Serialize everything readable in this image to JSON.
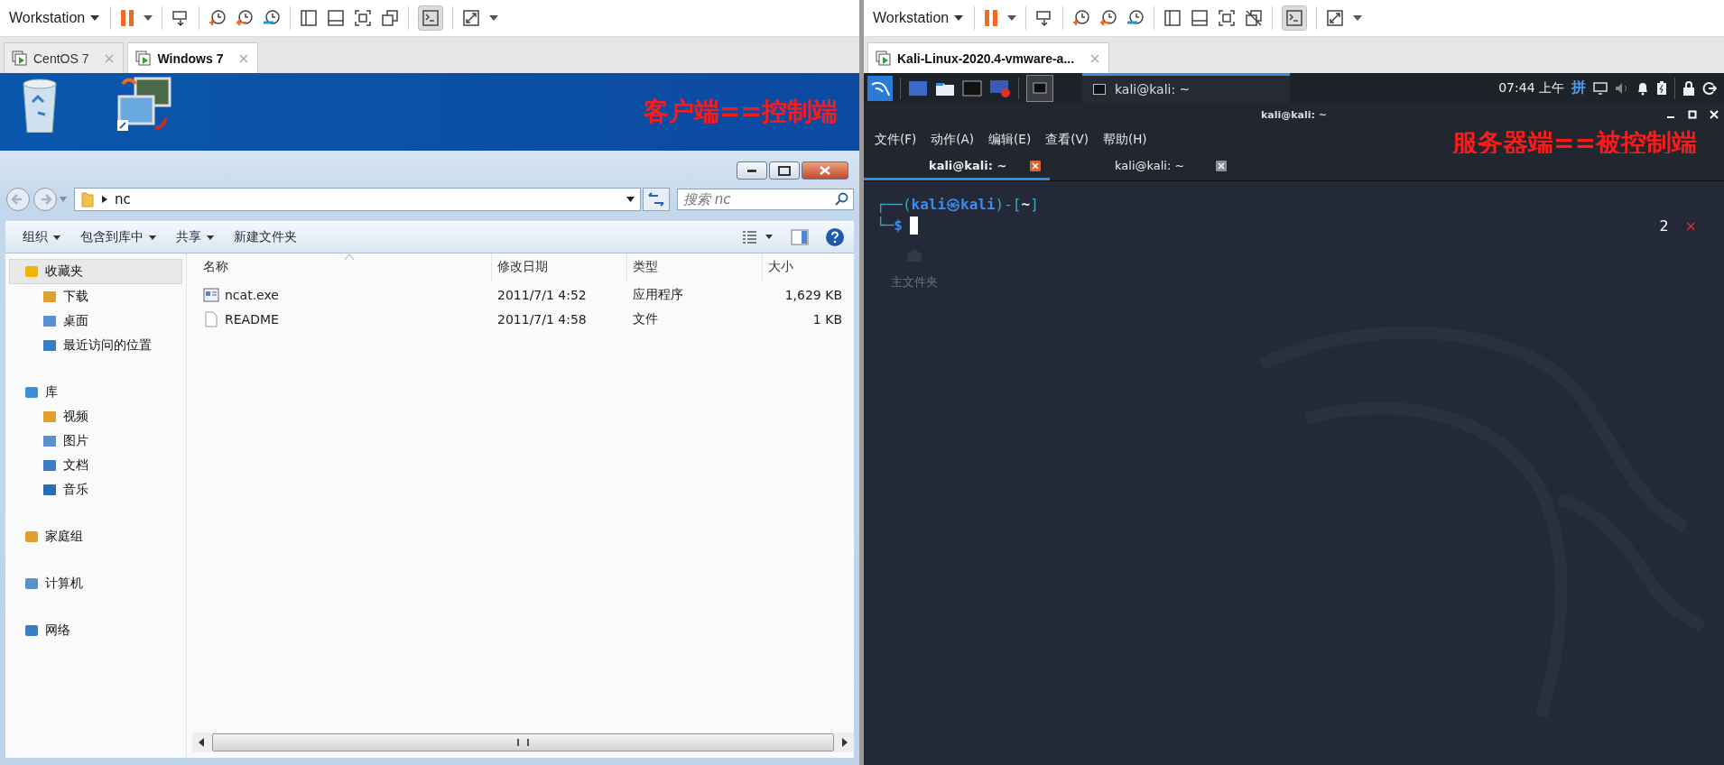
{
  "left": {
    "toolbar": {
      "menu": "Workstation"
    },
    "vm_tabs": [
      {
        "label": "CentOS 7",
        "selected": false
      },
      {
        "label": "Windows 7",
        "selected": true
      }
    ],
    "annotation": "客户端==控制端",
    "explorer": {
      "path": "nc",
      "search": {
        "placeholder": "搜索 nc"
      },
      "commands": [
        {
          "label": "组织",
          "dropdown": true
        },
        {
          "label": "包含到库中",
          "dropdown": true
        },
        {
          "label": "共享",
          "dropdown": true
        },
        {
          "label": "新建文件夹",
          "dropdown": false
        }
      ],
      "sidebar": [
        {
          "label": "收藏夹",
          "selected": true,
          "children": [
            {
              "label": "下载",
              "selected": false
            },
            {
              "label": "桌面",
              "selected": false
            },
            {
              "label": "最近访问的位置",
              "selected": false
            }
          ]
        },
        {
          "label": "库",
          "selected": false,
          "children": [
            {
              "label": "视频",
              "selected": false
            },
            {
              "label": "图片",
              "selected": false
            },
            {
              "label": "文档",
              "selected": false
            },
            {
              "label": "音乐",
              "selected": false
            }
          ]
        },
        {
          "label": "家庭组",
          "selected": false
        },
        {
          "label": "计算机",
          "selected": false
        },
        {
          "label": "网络",
          "selected": false
        }
      ],
      "columns": [
        "名称",
        "修改日期",
        "类型",
        "大小"
      ],
      "files": [
        {
          "name": "ncat.exe",
          "date": "2011/7/1 4:52",
          "type": "应用程序",
          "size": "1,629 KB",
          "kind": "exe"
        },
        {
          "name": "README",
          "date": "2011/7/1 4:58",
          "type": "文件",
          "size": "1 KB",
          "kind": "file"
        }
      ]
    }
  },
  "right": {
    "toolbar": {
      "menu": "Workstation"
    },
    "vm_tabs": [
      {
        "label": "Kali-Linux-2020.4-vmware-a...",
        "selected": true
      }
    ],
    "panel": {
      "window_button": "kali@kali: ~",
      "clock": "07:44 上午",
      "input_method": "拼"
    },
    "desktop_label": "主文件夹",
    "terminal": {
      "title": "kali@kali: ~",
      "menu": [
        "文件(F)",
        "动作(A)",
        "编辑(E)",
        "查看(V)",
        "帮助(H)"
      ],
      "tabs": [
        {
          "label": "kali@kali: ~",
          "selected": true
        },
        {
          "label": "kali@kali: ~",
          "selected": false
        }
      ],
      "lines": [
        [
          {
            "text": "┌──(",
            "kind": "frame"
          },
          {
            "text": "kali㉿kali",
            "kind": "user"
          },
          {
            "text": ")-[",
            "kind": "frame"
          },
          {
            "text": "~",
            "kind": "path"
          },
          {
            "text": "]",
            "kind": "frame"
          }
        ],
        [
          {
            "text": "└─",
            "kind": "frame"
          },
          {
            "text": "$",
            "kind": "user"
          }
        ]
      ],
      "job_count": "2",
      "job_mark": "×"
    },
    "annotation": "服务器端==被控制端"
  }
}
